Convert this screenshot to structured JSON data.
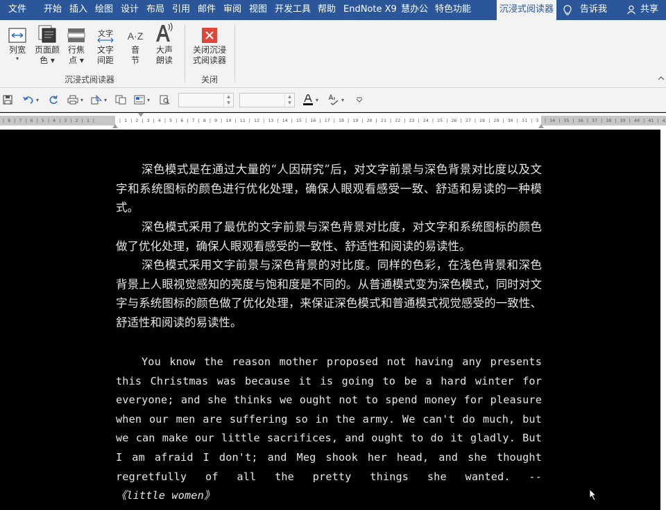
{
  "tabs": [
    {
      "label": "文件"
    },
    {
      "label": "开始"
    },
    {
      "label": "插入"
    },
    {
      "label": "绘图"
    },
    {
      "label": "设计"
    },
    {
      "label": "布局"
    },
    {
      "label": "引用"
    },
    {
      "label": "邮件"
    },
    {
      "label": "审阅"
    },
    {
      "label": "视图"
    },
    {
      "label": "开发工具"
    },
    {
      "label": "帮助"
    },
    {
      "label": "EndNote X9"
    },
    {
      "label": "慧办公"
    },
    {
      "label": "特色功能"
    },
    {
      "label": "沉浸式阅读器"
    }
  ],
  "tell_me": "告诉我",
  "share": "共享",
  "ribbon": {
    "buttons": [
      {
        "label": "列宽",
        "dropdown": "▾"
      },
      {
        "label": "页面颜",
        "label2": "色 ▾"
      },
      {
        "label": "行焦",
        "label2": "点 ▾"
      },
      {
        "label": "文字",
        "label2": "间距",
        "icon_text": "文字"
      },
      {
        "label": "音",
        "label2": "节",
        "icon_text": "A·Z"
      },
      {
        "label": "大声",
        "label2": "朗读"
      },
      {
        "label": "关闭沉浸",
        "label2": "式阅读器"
      }
    ],
    "groups": [
      {
        "label": "沉浸式阅读器"
      },
      {
        "label": "关闭"
      }
    ]
  },
  "colors": {
    "accent": "#2b579a",
    "close_red": "#e0473b",
    "doc_bg": "#000000",
    "doc_text": "#e6e6e6"
  },
  "ruler": {
    "left": "| 8 | 7 | 6 | 5 | 4 | 3 | 2 | 1 |",
    "main": "| 1 | 2 | 3 | 4 | 5 | 6 | 7 | 8 | 9 | 10 | 11 | 12 | 13 | 14 | 15 | 16 | 17 | 18 | 19 | 20 | 21 | 22 | 23 | 24 | 25 | 26 | 27 | 28 | 29 | 30 | 31 | 32 |",
    "right": "| 34 | 35 | 36 | 37 | 38 | 39 | 40 | 41 | 42 |"
  },
  "document": {
    "paragraphs": [
      "深色模式是在通过大量的“人因研究”后，对文字前景与深色背景对比度以及文字和系统图标的颜色进行优化处理，确保人眼观看感受一致、舒适和易读的一种模式。",
      "深色模式采用了最优的文字前景与深色背景对比度，对文字和系统图标的颜色做了优化处理，确保人眼观看感受的一致性、舒适性和阅读的易读性。",
      "深色模式采用文字前景与深色背景的对比度。同样的色彩，在浅色背景和深色背景上人眼视觉感知的亮度与饱和度是不同的。从普通模式变为深色模式，同时对文字与系统图标的颜色做了优化处理，来保证深色模式和普通模式视觉感受的一致性、舒适性和阅读的易读性。"
    ],
    "english": "You know the reason mother proposed not having any presents this Christmas was because it is going to be a hard winter for everyone; and she thinks we ought not to spend money for pleasure when our men are suffering so in the army. We can't do much, but we can make our little sacrifices, and ought to do it gladly. But I am afraid I don't; and Meg shook her head, and she thought regretfully of all the pretty things she wanted. --",
    "source": "《little women》"
  }
}
